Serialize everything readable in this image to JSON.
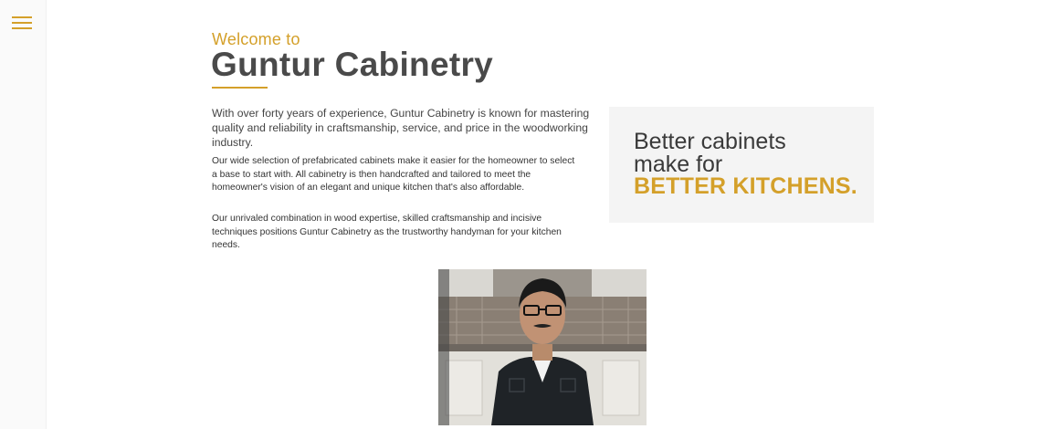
{
  "sidebar": {
    "menu_icon": "hamburger-menu-icon"
  },
  "hero": {
    "welcome": "Welcome to",
    "title": "Guntur Cabinetry"
  },
  "content": {
    "intro": "With over forty years of experience, Guntur Cabinetry is known for mastering quality and reliability in craftsmanship, service, and price in the woodworking industry.",
    "paragraphs": [
      "Our wide selection of prefabricated cabinets make it easier for the homeowner to select a base to start with. All cabinetry is then handcrafted and tailored to meet the homeowner's vision of an elegant and unique kitchen that's also affordable.",
      "Our unrivaled combination in wood expertise, skilled craftsmanship and incisive techniques positions Guntur Cabinetry as the trustworthy handyman for your kitchen needs."
    ]
  },
  "promo": {
    "line1": "Better cabinets",
    "line2": "make for",
    "line3": "BETTER KITCHENS."
  },
  "colors": {
    "accent": "#d4a02a",
    "heading": "#4a4a4a",
    "promo_bg": "#f4f4f4"
  }
}
